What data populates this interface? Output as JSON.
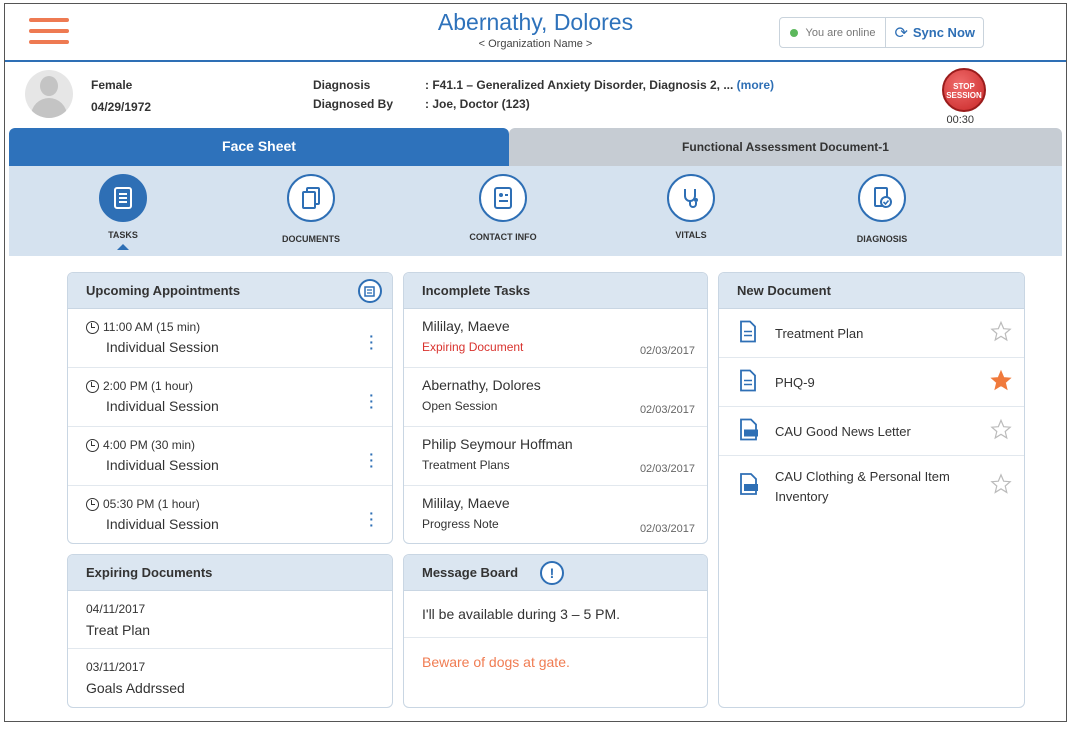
{
  "header": {
    "patient_name": "Abernathy, Dolores",
    "org_name": "< Organization Name >",
    "online_status": "You are online",
    "sync_label": "Sync Now"
  },
  "patient": {
    "sex": "Female",
    "dob": "04/29/1972",
    "diagnosis_label": "Diagnosis",
    "diagnosed_by_label": "Diagnosed By",
    "diagnosis_value": ": F41.1 –  Generalized Anxiety Disorder, Diagnosis 2, ... ",
    "more_link": "(more)",
    "diagnosed_by_value": ": Joe, Doctor (123)",
    "stop_label_1": "STOP",
    "stop_label_2": "SESSION",
    "timer": "00:30"
  },
  "tabs": {
    "face_sheet": "Face Sheet",
    "functional": "Functional Assessment Document-1"
  },
  "subnav": [
    {
      "label": "TASKS",
      "icon": "tasks-icon"
    },
    {
      "label": "DOCUMENTS",
      "icon": "documents-icon"
    },
    {
      "label": "CONTACT INFO",
      "icon": "contact-info-icon"
    },
    {
      "label": "VITALS",
      "icon": "stethoscope-icon"
    },
    {
      "label": "DIAGNOSIS",
      "icon": "diagnosis-icon"
    }
  ],
  "appointments": {
    "title": "Upcoming Appointments",
    "items": [
      {
        "time": "11:00 AM (15 min)",
        "title": "Individual Session"
      },
      {
        "time": "2:00 PM (1 hour)",
        "title": "Individual Session"
      },
      {
        "time": "4:00 PM (30 min)",
        "title": "Individual Session"
      },
      {
        "time": "05:30 PM (1 hour)",
        "title": "Individual Session"
      }
    ]
  },
  "tasks": {
    "title": "Incomplete Tasks",
    "items": [
      {
        "name": "Mililay, Maeve",
        "type": "Expiring Document",
        "date": "02/03/2017"
      },
      {
        "name": "Abernathy, Dolores",
        "type": "Open Session",
        "date": "02/03/2017"
      },
      {
        "name": "Philip Seymour Hoffman",
        "type": "Treatment Plans",
        "date": "02/03/2017"
      },
      {
        "name": "Mililay, Maeve",
        "type": "Progress Note",
        "date": "02/03/2017"
      }
    ]
  },
  "new_document": {
    "title": "New Document",
    "items": [
      {
        "label": "Treatment Plan",
        "favorite": false
      },
      {
        "label": "PHQ-9",
        "favorite": true
      },
      {
        "label": "CAU Good News Letter",
        "favorite": false
      },
      {
        "label": "CAU Clothing & Personal Item Inventory",
        "favorite": false
      }
    ]
  },
  "expiring": {
    "title": "Expiring Documents",
    "items": [
      {
        "date": "04/11/2017",
        "title": "Treat Plan"
      },
      {
        "date": "03/11/2017",
        "title": "Goals Addrssed"
      }
    ]
  },
  "messages": {
    "title": "Message Board",
    "items": [
      {
        "text": "I'll be available during 3 – 5 PM."
      },
      {
        "text": "Beware of dogs at gate."
      }
    ]
  },
  "colors": {
    "brand_blue": "#2e72bb",
    "accent_orange": "#ee7a52",
    "alert_red": "#d9332e",
    "star_orange": "#f07a3c"
  }
}
